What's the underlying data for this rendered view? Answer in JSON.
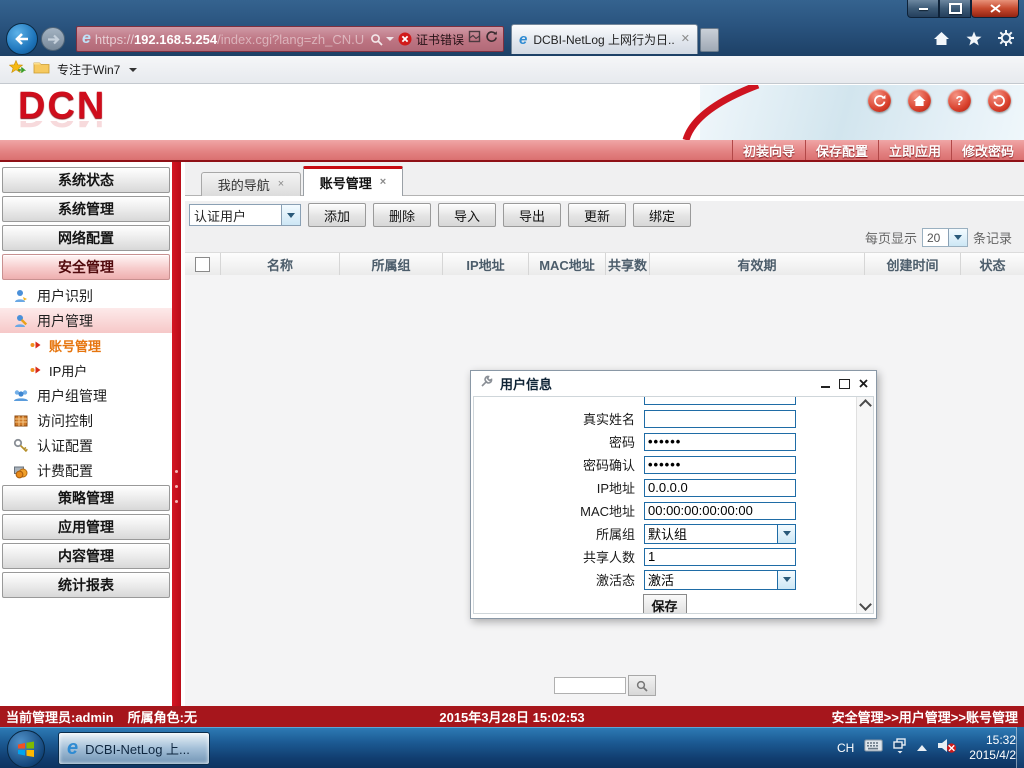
{
  "browser": {
    "url": {
      "scheme": "https://",
      "host": "192.168.5.254",
      "path": "/index.cgi?lang=zh_CN.U"
    },
    "cert_error_label": "证书错误",
    "tab_title": "DCBI-NetLog 上网行为日...",
    "favorites_bar_item": "专注于Win7"
  },
  "header": {
    "logo_text": "DCN",
    "quick_buttons": [
      "初装向导",
      "保存配置",
      "立即应用",
      "修改密码"
    ],
    "round_buttons": [
      "refresh",
      "home",
      "help",
      "logout"
    ],
    "help_glyph": "?"
  },
  "sidebar": {
    "items": [
      {
        "label": "系统状态"
      },
      {
        "label": "系统管理"
      },
      {
        "label": "网络配置"
      },
      {
        "label": "安全管理"
      },
      {
        "label": "用户识别"
      },
      {
        "label": "用户管理"
      },
      {
        "label": "账号管理"
      },
      {
        "label": "IP用户"
      },
      {
        "label": "用户组管理"
      },
      {
        "label": "访问控制"
      },
      {
        "label": "认证配置"
      },
      {
        "label": "计费配置"
      },
      {
        "label": "策略管理"
      },
      {
        "label": "应用管理"
      },
      {
        "label": "内容管理"
      },
      {
        "label": "统计报表"
      }
    ]
  },
  "content": {
    "tabs": [
      {
        "label": "我的导航"
      },
      {
        "label": "账号管理"
      }
    ],
    "toolbar": {
      "user_type_select": "认证用户",
      "buttons": [
        "添加",
        "删除",
        "导入",
        "导出",
        "更新",
        "绑定"
      ]
    },
    "pagination": {
      "prefix": "每页显示",
      "page_size": "20",
      "suffix": "条记录"
    },
    "table": {
      "columns": [
        "名称",
        "所属组",
        "IP地址",
        "MAC地址",
        "共享数",
        "有效期",
        "创建时间",
        "状态"
      ]
    }
  },
  "dialog": {
    "title": "用户信息",
    "fields": [
      {
        "label": "真实姓名",
        "value": ""
      },
      {
        "label": "密码",
        "value": "••••••"
      },
      {
        "label": "密码确认",
        "value": "••••••"
      },
      {
        "label": "IP地址",
        "value": "0.0.0.0"
      },
      {
        "label": "MAC地址",
        "value": "00:00:00:00:00:00"
      },
      {
        "label": "所属组",
        "value": "默认组"
      },
      {
        "label": "共享人数",
        "value": "1"
      },
      {
        "label": "激活态",
        "value": "激活"
      }
    ],
    "save_label": "保存"
  },
  "statusbar": {
    "admin": "当前管理员:admin",
    "role": "所属角色:无",
    "datetime": "2015年3月28日 15:02:53",
    "breadcrumb": "安全管理>>用户管理>>账号管理"
  },
  "taskbar": {
    "ie_window_label": "DCBI-NetLog 上...",
    "language": "CH",
    "time": "15:32",
    "date": "2015/4/2"
  }
}
